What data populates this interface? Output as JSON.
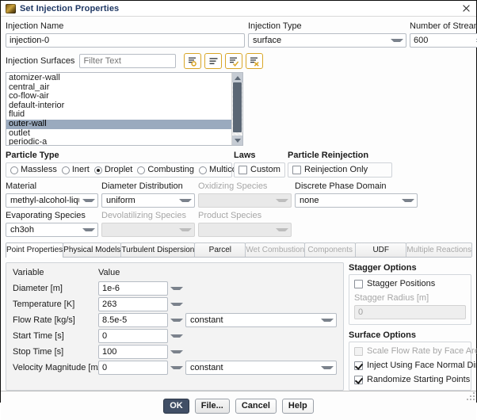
{
  "window": {
    "title": "Set Injection Properties",
    "icon": "fluent-app-icon",
    "close_icon": "close-icon"
  },
  "header": {
    "injection_name_label": "Injection Name",
    "injection_name_value": "injection-0",
    "injection_type_label": "Injection Type",
    "injection_type_value": "surface",
    "number_of_streams_label": "Number of Streams",
    "number_of_streams_value": "600"
  },
  "surfaces": {
    "label": "Injection Surfaces",
    "filter_placeholder": "Filter Text",
    "filter_value": "",
    "tools": [
      {
        "name": "filter-list-icon",
        "title": "Filter"
      },
      {
        "name": "list-all-icon",
        "title": "List All"
      },
      {
        "name": "select-all-icon",
        "title": "Select All"
      },
      {
        "name": "deselect-all-icon",
        "title": "Deselect All"
      }
    ],
    "items": [
      {
        "label": "atomizer-wall",
        "selected": false
      },
      {
        "label": "central_air",
        "selected": false
      },
      {
        "label": "co-flow-air",
        "selected": false
      },
      {
        "label": "default-interior",
        "selected": false
      },
      {
        "label": "fluid",
        "selected": false
      },
      {
        "label": "outer-wall",
        "selected": true
      },
      {
        "label": "outlet",
        "selected": false
      },
      {
        "label": "periodic-a",
        "selected": false
      }
    ]
  },
  "particle_type": {
    "label": "Particle Type",
    "options": [
      {
        "label": "Massless",
        "selected": false
      },
      {
        "label": "Inert",
        "selected": false
      },
      {
        "label": "Droplet",
        "selected": true
      },
      {
        "label": "Combusting",
        "selected": false
      },
      {
        "label": "Multicomponent",
        "selected": false
      }
    ]
  },
  "laws": {
    "label": "Laws",
    "custom_label": "Custom",
    "custom_checked": false
  },
  "reinjection": {
    "label": "Particle Reinjection",
    "only_label": "Reinjection Only",
    "only_checked": false
  },
  "species": {
    "material_label": "Material",
    "material_value": "methyl-alcohol-liquid",
    "diameter_distribution_label": "Diameter Distribution",
    "diameter_distribution_value": "uniform",
    "oxidizing_species_label": "Oxidizing Species",
    "oxidizing_species_value": "",
    "discrete_phase_domain_label": "Discrete Phase Domain",
    "discrete_phase_domain_value": "none",
    "evaporating_species_label": "Evaporating Species",
    "evaporating_species_value": "ch3oh",
    "devolatilizing_species_label": "Devolatilizing Species",
    "devolatilizing_species_value": "",
    "product_species_label": "Product Species",
    "product_species_value": ""
  },
  "tabs": [
    {
      "label": "Point Properties",
      "active": true,
      "disabled": false
    },
    {
      "label": "Physical Models",
      "active": false,
      "disabled": false
    },
    {
      "label": "Turbulent Dispersion",
      "active": false,
      "disabled": false
    },
    {
      "label": "Parcel",
      "active": false,
      "disabled": false
    },
    {
      "label": "Wet Combustion",
      "active": false,
      "disabled": true
    },
    {
      "label": "Components",
      "active": false,
      "disabled": true
    },
    {
      "label": "UDF",
      "active": false,
      "disabled": false
    },
    {
      "label": "Multiple Reactions",
      "active": false,
      "disabled": true
    }
  ],
  "point_properties": {
    "variable_header": "Variable",
    "value_header": "Value",
    "rows": [
      {
        "variable": "Diameter [m]",
        "value": "1e-6",
        "method": null
      },
      {
        "variable": "Temperature [K]",
        "value": "263",
        "method": null
      },
      {
        "variable": "Flow Rate [kg/s]",
        "value": "8.5e-5",
        "method": "constant"
      },
      {
        "variable": "Start Time [s]",
        "value": "0",
        "method": null
      },
      {
        "variable": "Stop Time [s]",
        "value": "100",
        "method": null
      },
      {
        "variable": "Velocity Magnitude [m/s]",
        "value": "0",
        "method": "constant"
      }
    ]
  },
  "stagger_options": {
    "title": "Stagger Options",
    "stagger_positions_label": "Stagger Positions",
    "stagger_positions_checked": false,
    "stagger_radius_label": "Stagger Radius [m]",
    "stagger_radius_value": "0",
    "stagger_radius_disabled": true
  },
  "surface_options": {
    "title": "Surface Options",
    "items": [
      {
        "label": "Scale Flow Rate by Face Area",
        "checked": false,
        "disabled": true
      },
      {
        "label": "Inject Using Face Normal Direction",
        "checked": true,
        "disabled": false
      },
      {
        "label": "Randomize Starting Points",
        "checked": true,
        "disabled": false
      }
    ]
  },
  "footer": {
    "ok_label": "OK",
    "file_label": "File...",
    "cancel_label": "Cancel",
    "help_label": "Help"
  },
  "colors": {
    "title_blue": "#1f3864",
    "selection_blue": "#9aaabe",
    "primary_button": "#414f66",
    "icon_accent": "#d9a627"
  }
}
